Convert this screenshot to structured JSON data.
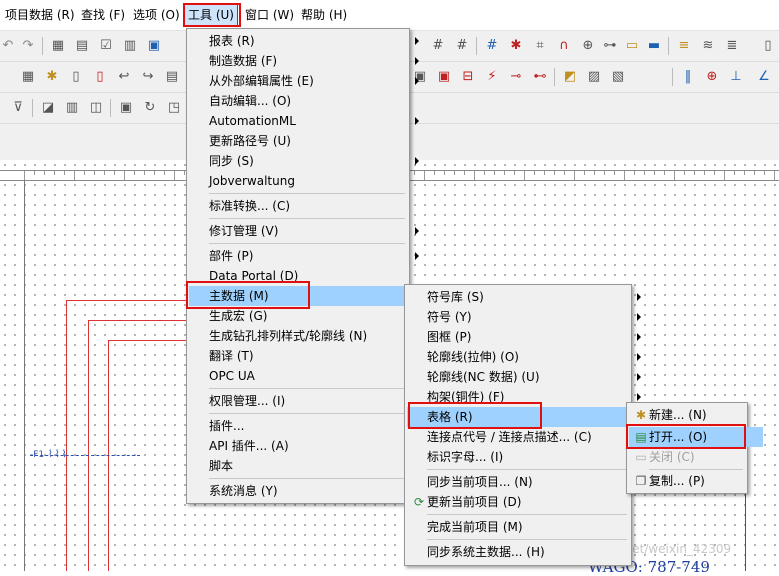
{
  "menubar": {
    "items": [
      {
        "label": "项目数据 (R)"
      },
      {
        "label": "查找 (F)"
      },
      {
        "label": "选项 (O)"
      },
      {
        "label": "工具 (U)"
      },
      {
        "label": "窗口 (W)"
      },
      {
        "label": "帮助 (H)"
      }
    ]
  },
  "tools_menu": {
    "items": [
      {
        "label": "报表 (R)"
      },
      {
        "label": "制造数据 (F)"
      },
      {
        "label": "从外部编辑属性 (E)"
      },
      {
        "label": "自动编辑... (O)"
      },
      {
        "label": "AutomationML"
      },
      {
        "label": "更新路径号 (U)"
      },
      {
        "label": "同步 (S)"
      },
      {
        "label": "Jobverwaltung"
      },
      {
        "label": "标准转换... (C)"
      },
      {
        "label": "修订管理 (V)"
      },
      {
        "label": "部件 (P)"
      },
      {
        "label": "Data Portal (D)"
      },
      {
        "label": "主数据 (M)"
      },
      {
        "label": "生成宏 (G)"
      },
      {
        "label": "生成钻孔排列样式/轮廓线 (N)"
      },
      {
        "label": "翻译 (T)"
      },
      {
        "label": "OPC UA"
      },
      {
        "label": "权限管理... (I)"
      },
      {
        "label": "插件..."
      },
      {
        "label": "API 插件... (A)"
      },
      {
        "label": "脚本"
      },
      {
        "label": "系统消息 (Y)"
      }
    ]
  },
  "master_menu": {
    "items": [
      {
        "label": "符号库 (S)"
      },
      {
        "label": "符号 (Y)"
      },
      {
        "label": "图框 (P)"
      },
      {
        "label": "轮廓线(拉伸) (O)"
      },
      {
        "label": "轮廓线(NC 数据) (U)"
      },
      {
        "label": "构架(铜件) (F)"
      },
      {
        "label": "表格 (R)"
      },
      {
        "label": "连接点代号 / 连接点描述... (C)"
      },
      {
        "label": "标识字母... (I)"
      },
      {
        "label": "同步当前项目... (N)"
      },
      {
        "label": "更新当前项目 (D)"
      },
      {
        "label": "完成当前项目 (M)"
      },
      {
        "label": "同步系统主数据... (H)"
      }
    ]
  },
  "form_menu": {
    "items": [
      {
        "label": "新建... (N)"
      },
      {
        "label": "打开... (O)"
      },
      {
        "label": "关闭 (C)"
      },
      {
        "label": "复制... (P)"
      }
    ]
  },
  "canvas": {
    "label_f1": "-F1",
    "label_wago": "WAGO: 787-749",
    "watermark": "https://blog.csdn.net/weixin_42309"
  },
  "colors": {
    "highlight": "#9fd1ff",
    "callout": "#e01010",
    "wire": "#d33333"
  }
}
